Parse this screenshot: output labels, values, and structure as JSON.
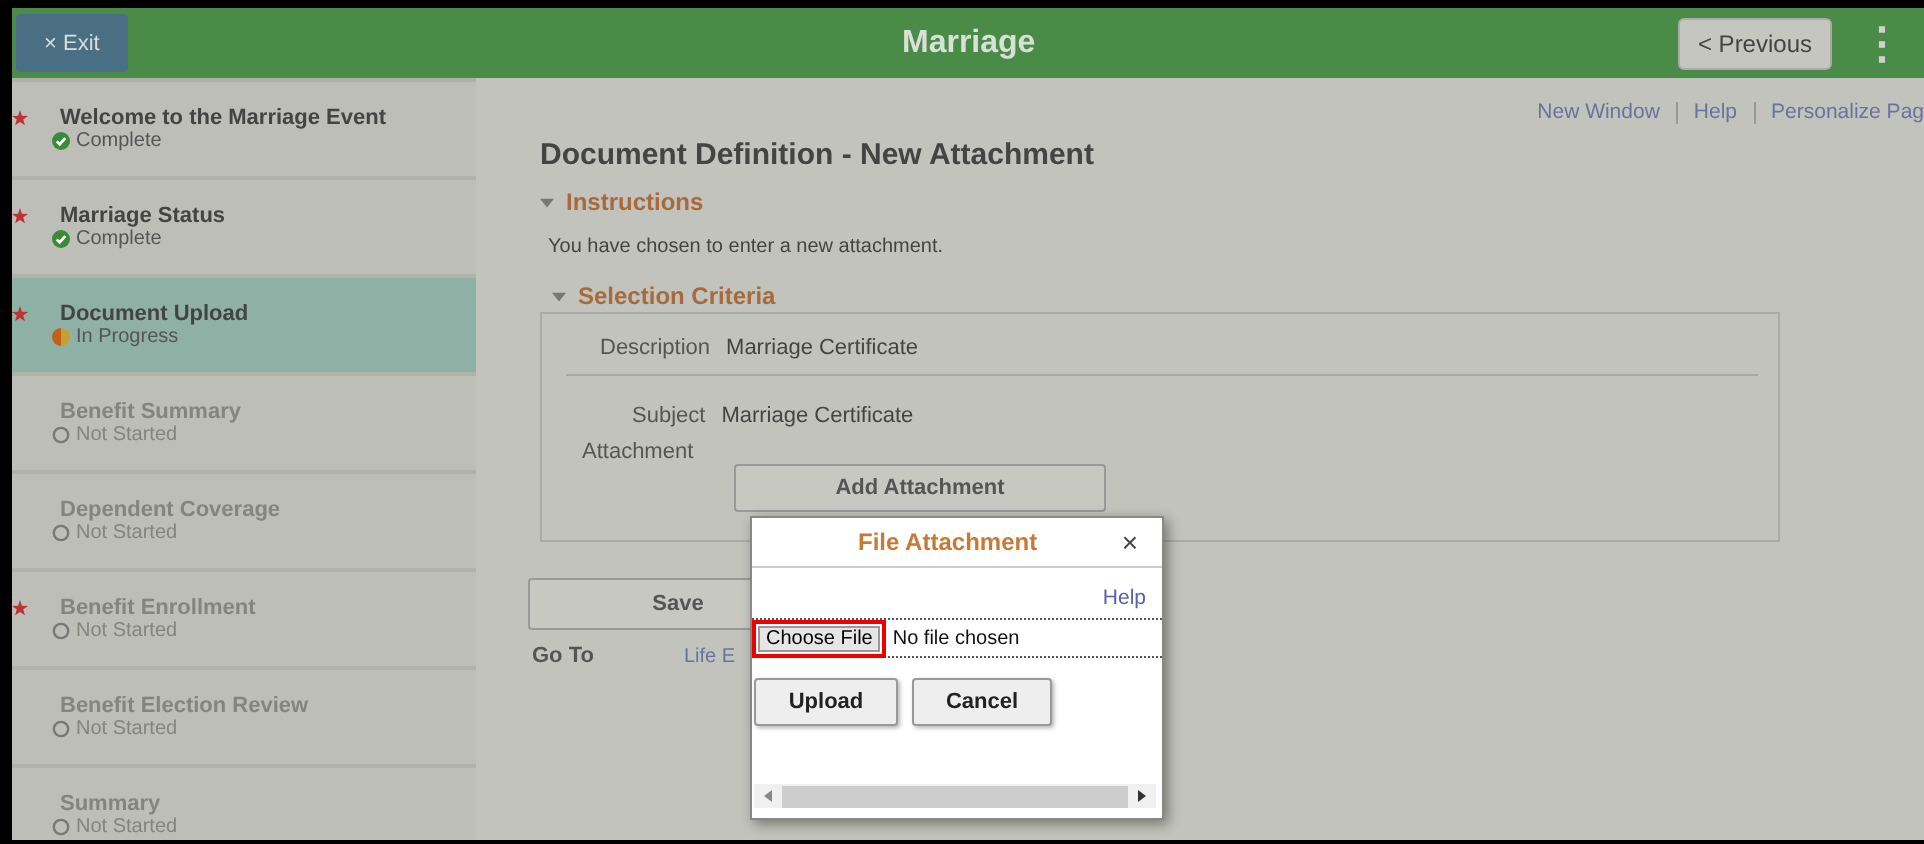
{
  "header": {
    "exit_button": "× Exit",
    "title": "Marriage",
    "previous_button": "< Previous",
    "menu_glyph": "⋮"
  },
  "sidebar": {
    "items": [
      {
        "title": "Welcome to the Marriage Event",
        "status": "Complete",
        "kind": "complete",
        "required": true,
        "selected": false
      },
      {
        "title": "Marriage Status",
        "status": "Complete",
        "kind": "complete",
        "required": true,
        "selected": false
      },
      {
        "title": "Document Upload",
        "status": "In Progress",
        "kind": "in_progress",
        "required": true,
        "selected": true
      },
      {
        "title": "Benefit Summary",
        "status": "Not Started",
        "kind": "not_started",
        "required": false,
        "selected": false
      },
      {
        "title": "Dependent Coverage",
        "status": "Not Started",
        "kind": "not_started",
        "required": false,
        "selected": false
      },
      {
        "title": "Benefit Enrollment",
        "status": "Not Started",
        "kind": "not_started",
        "required": true,
        "selected": false
      },
      {
        "title": "Benefit Election Review",
        "status": "Not Started",
        "kind": "not_started",
        "required": false,
        "selected": false
      },
      {
        "title": "Summary",
        "status": "Not Started",
        "kind": "not_started",
        "required": false,
        "selected": false
      }
    ]
  },
  "top_links": [
    "New Window",
    "Help",
    "Personalize Pag"
  ],
  "page_title": "Document Definition - New Attachment",
  "instructions": {
    "heading": "Instructions",
    "expanded": true,
    "text": "You have chosen to enter a new attachment."
  },
  "selection_criteria": {
    "heading": "Selection Criteria",
    "expanded": true,
    "description_label": "Description",
    "description_value": "Marriage Certificate",
    "subject_label": "Subject",
    "subject_value": "Marriage Certificate",
    "attachment_label": "Attachment",
    "add_attachment_button": "Add Attachment"
  },
  "save_button": "Save",
  "go_to_label": "Go To",
  "go_to_link": "Life E",
  "dialog": {
    "title": "File Attachment",
    "close_glyph": "×",
    "help_link": "Help",
    "choose_file_button": "Choose File",
    "file_status": "No file chosen",
    "choose_file_highlighted": true,
    "upload_button": "Upload",
    "cancel_button": "Cancel"
  }
}
